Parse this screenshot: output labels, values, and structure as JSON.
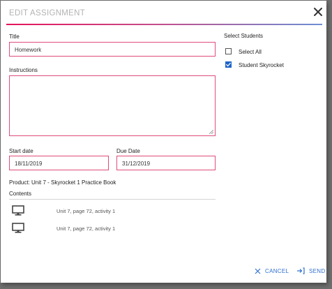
{
  "dialog": {
    "title": "EDIT ASSIGNMENT",
    "accent_colors": [
      "#e4145b",
      "#6b8fd4"
    ]
  },
  "form": {
    "title_label": "Title",
    "title_value": "Homework",
    "instructions_label": "Instructions",
    "instructions_value": "",
    "start_date_label": "Start date",
    "start_date_value": "18/11/2019",
    "due_date_label": "Due Date",
    "due_date_value": "31/12/2019",
    "product": "Product: Unit 7 - Skyrocket 1 Practice Book",
    "contents_label": "Contents",
    "contents": [
      {
        "icon": "monitor-icon",
        "text": "Unit 7, page 72, activity 1"
      },
      {
        "icon": "monitor-icon",
        "text": "Unit 7, page 72, activity 1"
      }
    ]
  },
  "students": {
    "heading": "Select Students",
    "options": [
      {
        "label": "Select All",
        "checked": false
      },
      {
        "label": "Student Skyrocket",
        "checked": true
      }
    ]
  },
  "footer": {
    "cancel_label": "CANCEL",
    "send_label": "SEND",
    "button_color": "#2f6fd0"
  }
}
